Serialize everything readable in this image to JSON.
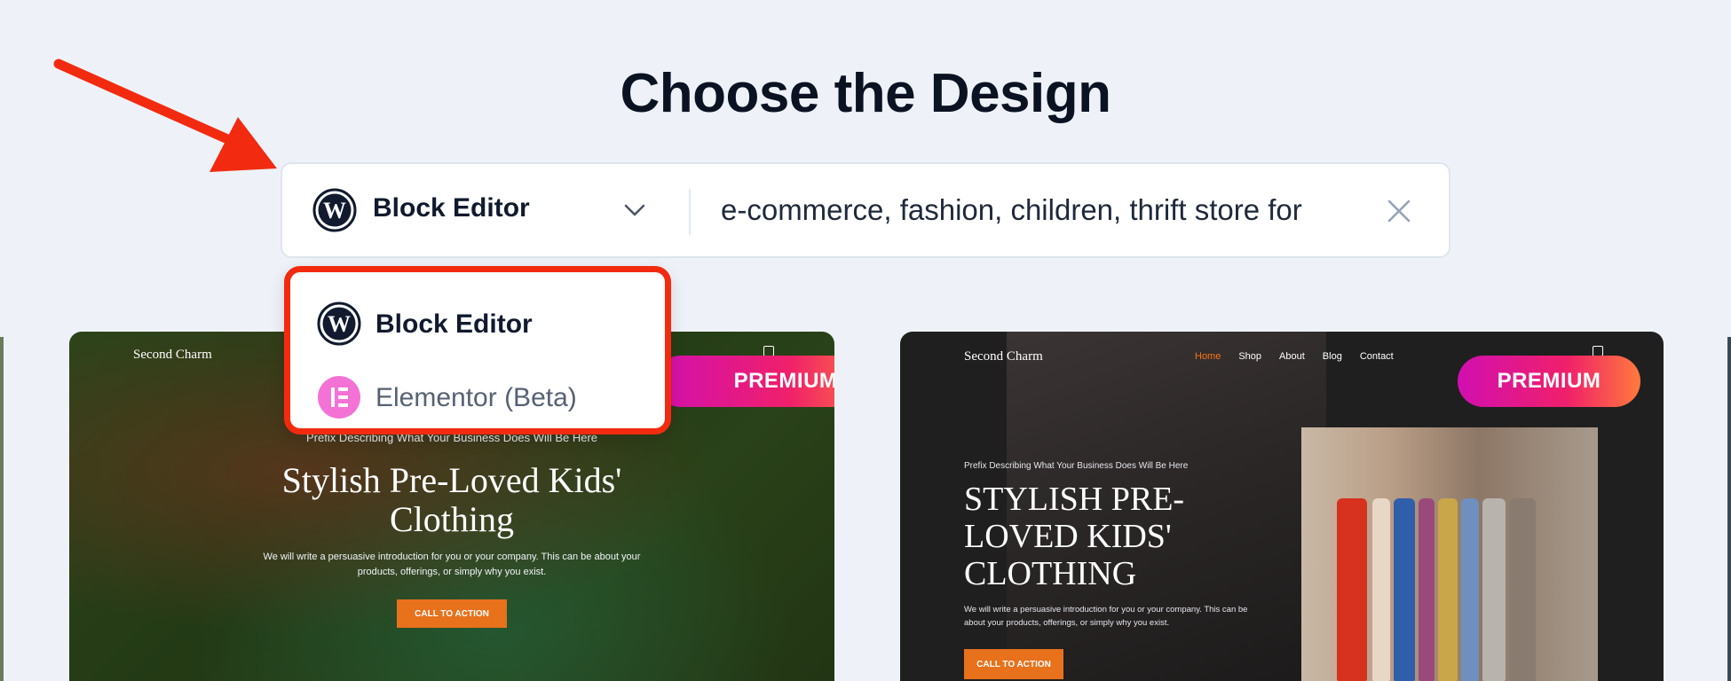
{
  "page": {
    "title": "Choose the Design"
  },
  "search_bar": {
    "builder_label": "Block Editor",
    "query": "e-commerce, fashion, children, thrift store for"
  },
  "builder_dropdown": {
    "options": [
      {
        "label": "Block Editor",
        "icon": "wordpress-icon"
      },
      {
        "label": "Elementor (Beta)",
        "icon": "elementor-icon"
      }
    ]
  },
  "cards": [
    {
      "brand": "Second Charm",
      "badge": "PREMIUM",
      "prefix": "Prefix Describing What Your Business Does Will Be Here",
      "title_line1": "Stylish Pre-Loved Kids'",
      "title_line2": "Clothing",
      "intro_line1": "We will write a persuasive introduction for you or your company. This can be about your",
      "intro_line2": "products, offerings, or simply why you exist.",
      "cta": "CALL TO ACTION"
    },
    {
      "brand": "Second Charm",
      "badge": "PREMIUM",
      "nav": [
        "Home",
        "Shop",
        "About",
        "Blog",
        "Contact"
      ],
      "prefix": "Prefix Describing What Your Business Does Will Be Here",
      "title_line1": "STYLISH PRE-",
      "title_line2": "LOVED KIDS'",
      "title_line3": "CLOTHING",
      "intro_line1": "We will write a persuasive introduction for you or your company. This can be",
      "intro_line2": "about your products, offerings, or simply why you exist.",
      "cta": "CALL TO ACTION"
    }
  ],
  "colors": {
    "accent_red": "#f22b10",
    "badge_gradient_start": "#d10fb0",
    "badge_gradient_end": "#ff7a3c",
    "cta_orange": "#e8711c",
    "elementor_pink": "#f472d6"
  }
}
